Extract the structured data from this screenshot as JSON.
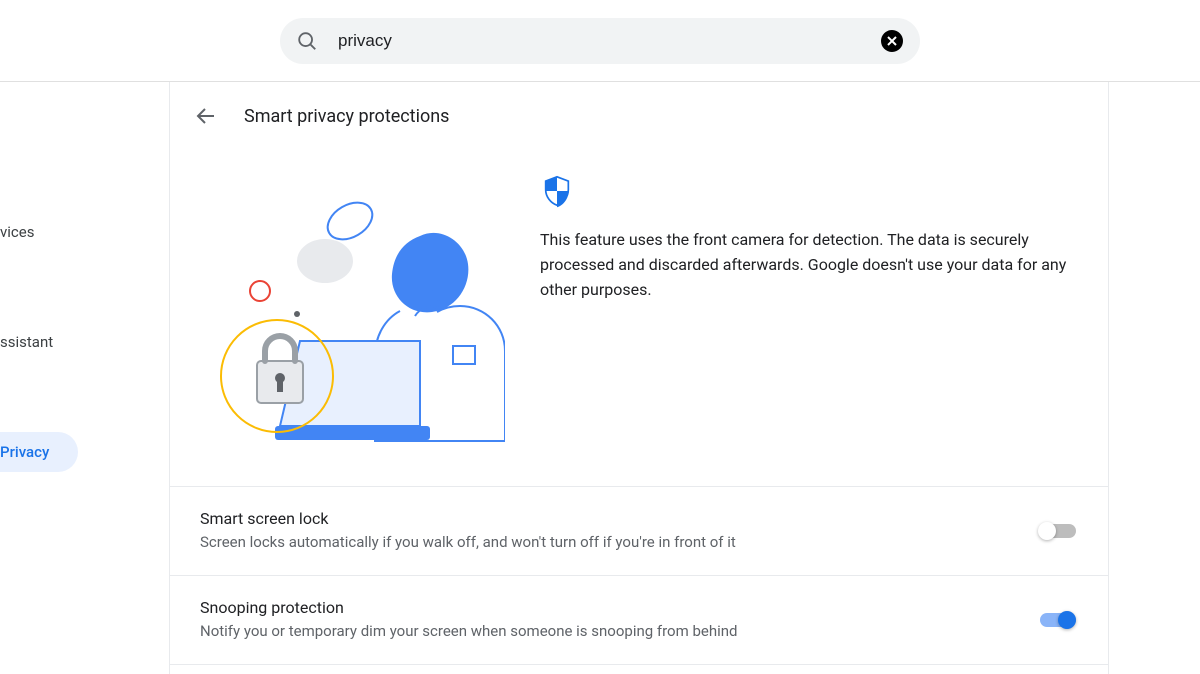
{
  "search": {
    "value": "privacy"
  },
  "sidebar": {
    "items": [
      {
        "label": "vices"
      },
      {
        "label": "ssistant"
      },
      {
        "label": "Privacy"
      }
    ]
  },
  "page": {
    "title": "Smart privacy protections",
    "description": "This feature uses the front camera for detection. The data is securely processed and discarded afterwards. Google doesn't use your data for any other purposes."
  },
  "settings": [
    {
      "title": "Smart screen lock",
      "subtitle": "Screen locks automatically if you walk off, and won't turn off if you're in front of it",
      "enabled": false
    },
    {
      "title": "Snooping protection",
      "subtitle": "Notify you or temporary dim your screen when someone is snooping from behind",
      "enabled": true
    }
  ],
  "colors": {
    "accent": "#1a73e8"
  }
}
